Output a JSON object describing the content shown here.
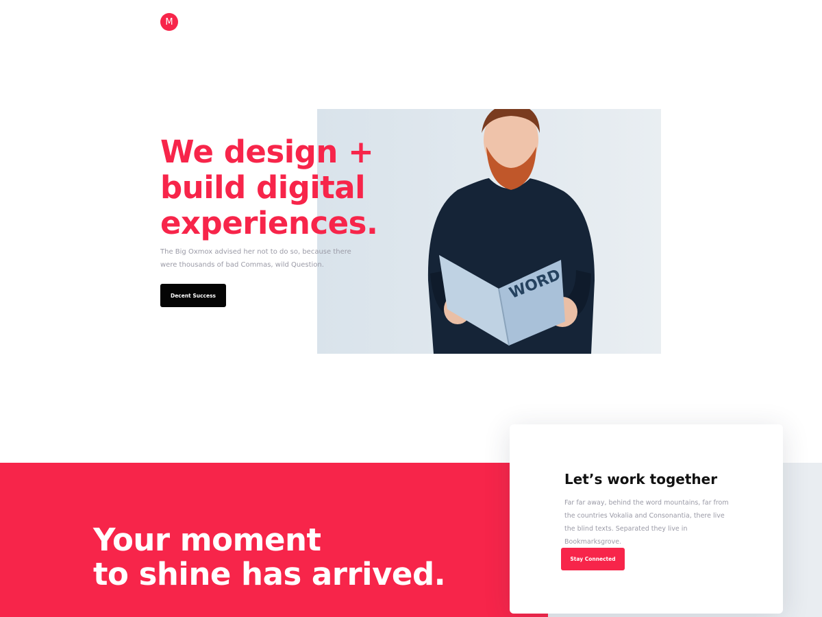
{
  "brand": {
    "logo_letter": "M",
    "accent_color": "#f7254a"
  },
  "hero": {
    "title_lines": [
      "We design +",
      "build digital",
      "experiences."
    ],
    "description": "The Big Oxmox advised her not to do so, because there were thousands of bad Commas, wild Question.",
    "button_label": "Decent Success",
    "image": {
      "subject": "man-reading-magazine",
      "magazine_cover_text": "WORD"
    }
  },
  "banner": {
    "title_lines": [
      "Your moment",
      "to shine has arrived."
    ],
    "background_color": "#f7254a"
  },
  "contact_card": {
    "title": "Let’s work together",
    "description": "Far far away, behind the word mountains, far from the countries Vokalia and Consonantia, there live the blind texts. Separated they live in Bookmarksgrove.",
    "button_label": "Stay Connected"
  }
}
